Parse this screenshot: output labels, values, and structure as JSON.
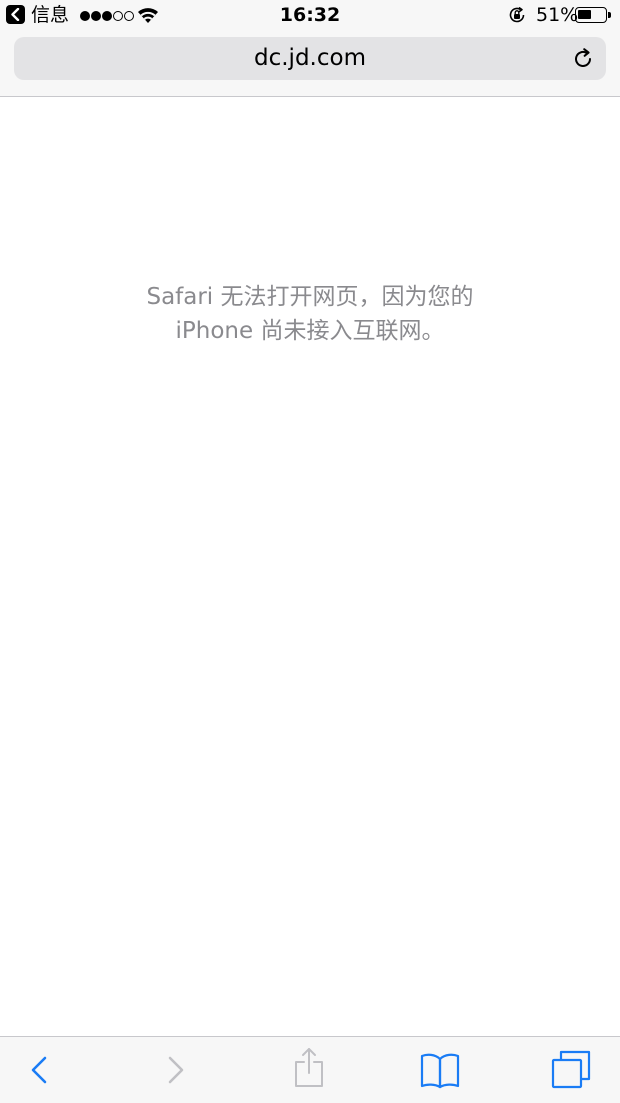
{
  "status_bar": {
    "back_app_label": "信息",
    "signal": {
      "filled": 3,
      "total": 5
    },
    "time": "16:32",
    "battery_percent": "51%",
    "battery_level": 0.51
  },
  "address_bar": {
    "url": "dc.jd.com"
  },
  "page": {
    "error_line1": "Safari 无法打开网页，因为您的",
    "error_line2": "iPhone 尚未接入互联网。"
  },
  "toolbar": {
    "back_enabled": true,
    "forward_enabled": false,
    "share_enabled": false,
    "accent_color": "#1a7cf5",
    "disabled_color": "#c0c0c4"
  }
}
